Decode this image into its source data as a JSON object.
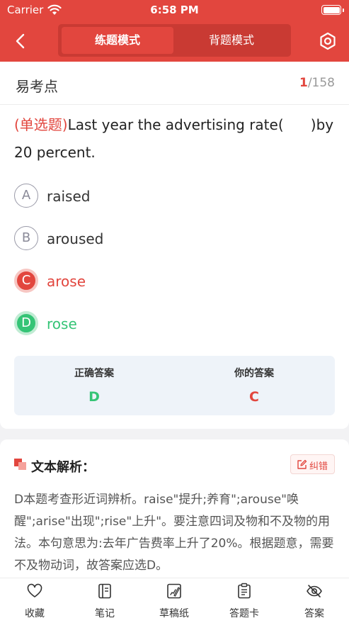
{
  "status_bar": {
    "carrier": "Carrier",
    "time": "6:58 PM"
  },
  "header": {
    "tabs": [
      {
        "label": "练题模式",
        "active": true
      },
      {
        "label": "背题模式",
        "active": false
      }
    ],
    "accent_color": "#e2463e"
  },
  "question": {
    "title": "易考点",
    "current": "1",
    "total": "/158",
    "type_label": "(单选题)",
    "text": "Last year the advertising rate(      )by 20 percent.",
    "options": [
      {
        "letter": "A",
        "text": "raised",
        "state": "normal"
      },
      {
        "letter": "B",
        "text": "aroused",
        "state": "normal"
      },
      {
        "letter": "C",
        "text": "arose",
        "state": "wrong"
      },
      {
        "letter": "D",
        "text": "rose",
        "state": "correct"
      }
    ]
  },
  "answers": {
    "correct_label": "正确答案",
    "correct_value": "D",
    "yours_label": "你的答案",
    "yours_value": "C"
  },
  "analysis": {
    "title": "文本解析：",
    "report_label": "纠错",
    "body": "D本题考查形近词辨析。raise\"提升;养育\";arouse\"唤醒\";arise\"出现\";rise\"上升\"。要注意四词及物和不及物的用法。本句意思为:去年广告费率上升了20%。根据题意，需要不及物动词，故答案应选D。"
  },
  "bottom_tabs": [
    {
      "label": "收藏",
      "icon": "heart-icon"
    },
    {
      "label": "笔记",
      "icon": "notebook-icon"
    },
    {
      "label": "草稿纸",
      "icon": "draft-paper-icon"
    },
    {
      "label": "答题卡",
      "icon": "answer-sheet-icon"
    },
    {
      "label": "答案",
      "icon": "eye-off-icon"
    }
  ],
  "colors": {
    "correct": "#35c476",
    "wrong": "#e2463e"
  }
}
